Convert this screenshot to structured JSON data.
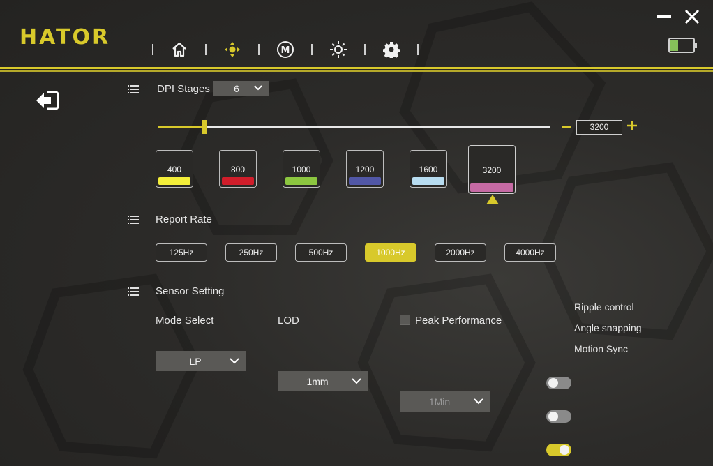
{
  "app": {
    "brand": "HATOR"
  },
  "colors": {
    "accent": "#d8c92b",
    "background": "#2c2b29"
  },
  "nav": {
    "icons": [
      "home-icon",
      "dpi-icon",
      "macro-icon",
      "lighting-icon",
      "settings-icon"
    ],
    "active": "dpi-icon",
    "macro_letter": "M"
  },
  "window": {
    "battery_level": 0.35
  },
  "dpi": {
    "section_label": "DPI Stages",
    "stages_selected": "6",
    "slider_value": 0.12,
    "current_value": "3200",
    "stages": [
      {
        "value": "400",
        "color": "#f3ee3a"
      },
      {
        "value": "800",
        "color": "#d01d2a"
      },
      {
        "value": "1000",
        "color": "#8cc640"
      },
      {
        "value": "1200",
        "color": "#5157a6"
      },
      {
        "value": "1600",
        "color": "#b7dcf0"
      },
      {
        "value": "3200",
        "color": "#c66aa4",
        "selected": true
      }
    ]
  },
  "report_rate": {
    "section_label": "Report Rate",
    "options": [
      "125Hz",
      "250Hz",
      "500Hz",
      "1000Hz",
      "2000Hz",
      "4000Hz"
    ],
    "selected": "1000Hz"
  },
  "sensor": {
    "section_label": "Sensor Setting",
    "mode_label": "Mode Select",
    "mode_value": "LP",
    "lod_label": "LOD",
    "lod_value": "1mm",
    "peak_label": "Peak Performance",
    "peak_checked": false,
    "peak_value": "1Min"
  },
  "toggles": [
    {
      "label": "Ripple control",
      "on": false
    },
    {
      "label": "Angle snapping",
      "on": false
    },
    {
      "label": "Motion Sync",
      "on": true
    }
  ]
}
